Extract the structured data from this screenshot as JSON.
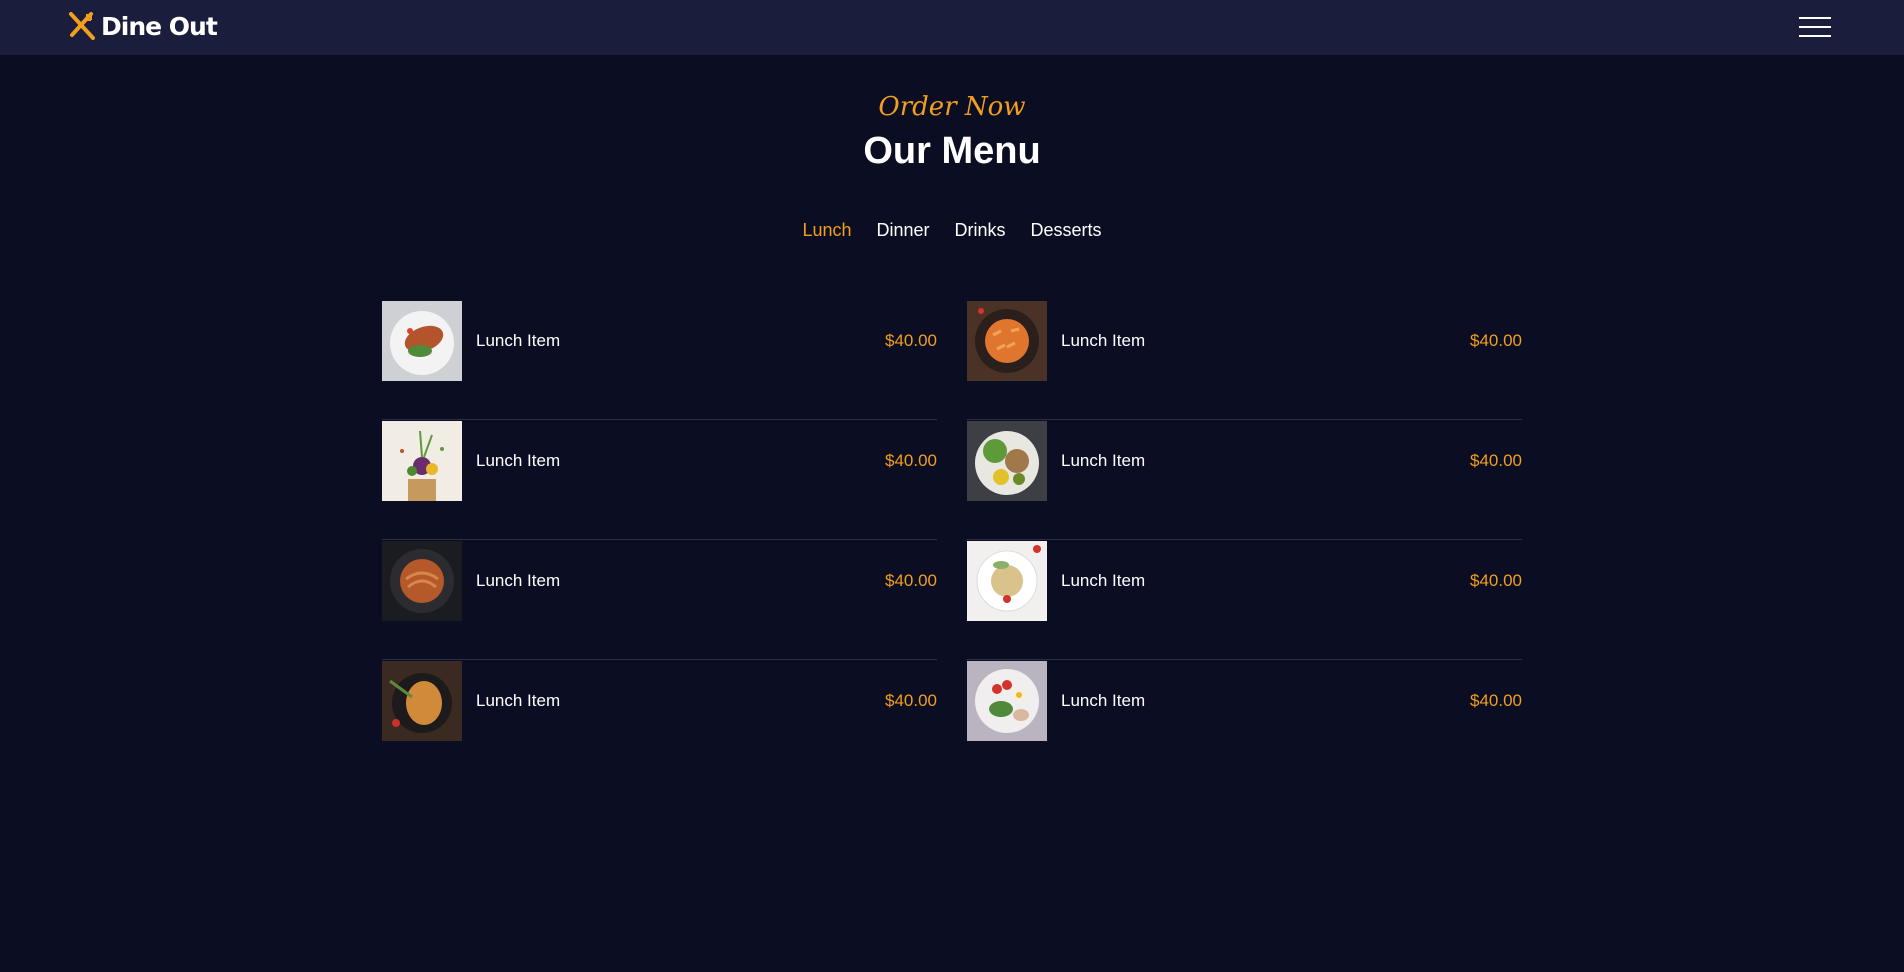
{
  "brand": {
    "name": "Dine Out",
    "accent": "#f29e1f"
  },
  "header": {
    "menu_icon": "hamburger-icon"
  },
  "section": {
    "eyebrow": "Order Now",
    "title": "Our Menu"
  },
  "tabs": [
    {
      "label": "Lunch",
      "active": true
    },
    {
      "label": "Dinner",
      "active": false
    },
    {
      "label": "Drinks",
      "active": false
    },
    {
      "label": "Desserts",
      "active": false
    }
  ],
  "menu": {
    "left": [
      {
        "name": "Lunch Item",
        "price": "$40.00",
        "image": "grilled-fish-plate"
      },
      {
        "name": "Lunch Item",
        "price": "$40.00",
        "image": "vegetables-bag"
      },
      {
        "name": "Lunch Item",
        "price": "$40.00",
        "image": "noodles-bowl"
      },
      {
        "name": "Lunch Item",
        "price": "$40.00",
        "image": "roast-chicken"
      }
    ],
    "right": [
      {
        "name": "Lunch Item",
        "price": "$40.00",
        "image": "penne-pasta"
      },
      {
        "name": "Lunch Item",
        "price": "$40.00",
        "image": "salad-bowl"
      },
      {
        "name": "Lunch Item",
        "price": "$40.00",
        "image": "rice-plate"
      },
      {
        "name": "Lunch Item",
        "price": "$40.00",
        "image": "egg-salad"
      }
    ]
  }
}
